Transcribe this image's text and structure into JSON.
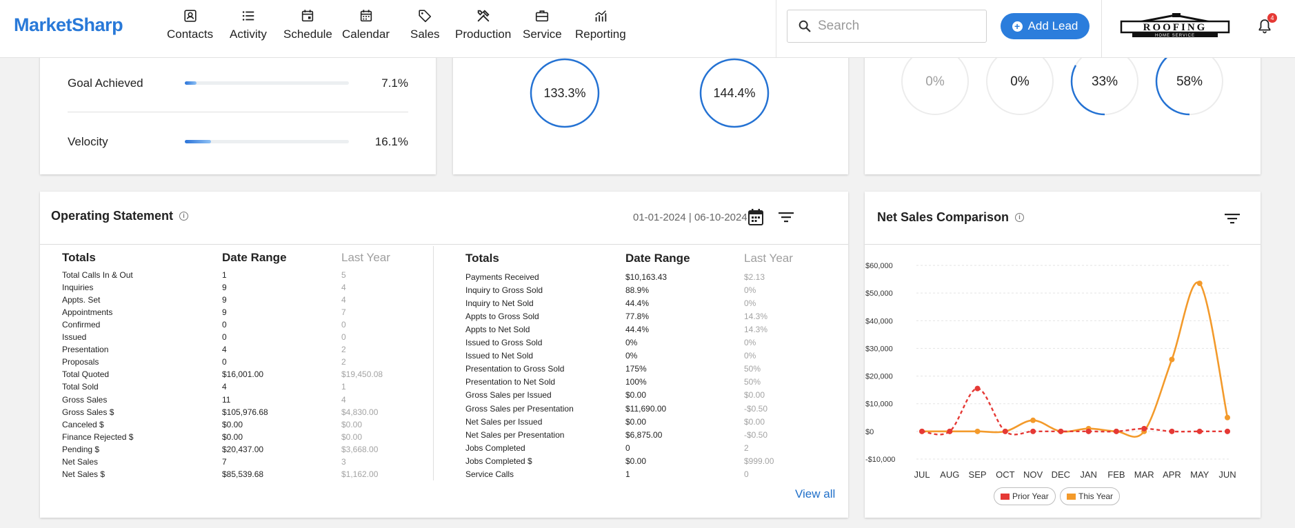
{
  "app": {
    "logo_text": "MarketSharp"
  },
  "nav": {
    "items": [
      {
        "label": "Contacts",
        "icon": "contacts-icon"
      },
      {
        "label": "Activity",
        "icon": "list-icon"
      },
      {
        "label": "Schedule",
        "icon": "calendar-event-icon"
      },
      {
        "label": "Calendar",
        "icon": "calendar-icon"
      },
      {
        "label": "Sales",
        "icon": "tag-icon"
      },
      {
        "label": "Production",
        "icon": "tools-icon"
      },
      {
        "label": "Service",
        "icon": "briefcase-icon"
      },
      {
        "label": "Reporting",
        "icon": "chart-icon"
      }
    ],
    "search_placeholder": "Search",
    "add_lead_label": "Add Lead",
    "brand_logo_text": "ROOFING",
    "brand_logo_subtext": "HOME SERVICE",
    "notification_count": "4"
  },
  "goals_card": {
    "rows": [
      {
        "label": "Goal Achieved",
        "value": "7.1%",
        "fill_percent": 7.1
      },
      {
        "label": "Velocity",
        "value": "16.1%",
        "fill_percent": 16.1
      }
    ]
  },
  "rings_card_middle": {
    "rings": [
      {
        "value": "133.3%",
        "fraction": 1.0
      },
      {
        "value": "144.4%",
        "fraction": 1.0
      }
    ]
  },
  "rings_card_right": {
    "rings": [
      {
        "value": "0%",
        "fraction": 0,
        "muted": true
      },
      {
        "value": "0%",
        "fraction": 0,
        "muted": false
      },
      {
        "value": "33%",
        "fraction": 0.33,
        "muted": false
      },
      {
        "value": "58%",
        "fraction": 0.58,
        "muted": false
      }
    ]
  },
  "operating_statement": {
    "title": "Operating Statement",
    "date_range": "01-01-2024 | 06-10-2024",
    "view_all_label": "View all",
    "left_table": {
      "headers": [
        "Totals",
        "Date Range",
        "Last Year"
      ],
      "rows": [
        [
          "Total Calls In & Out",
          "1",
          "5"
        ],
        [
          "Inquiries",
          "9",
          "4"
        ],
        [
          "Appts. Set",
          "9",
          "4"
        ],
        [
          "Appointments",
          "9",
          "7"
        ],
        [
          "Confirmed",
          "0",
          "0"
        ],
        [
          "Issued",
          "0",
          "0"
        ],
        [
          "Presentation",
          "4",
          "2"
        ],
        [
          "Proposals",
          "0",
          "2"
        ],
        [
          "Total Quoted",
          "$16,001.00",
          "$19,450.08"
        ],
        [
          "Total Sold",
          "4",
          "1"
        ],
        [
          "Gross Sales",
          "11",
          "4"
        ],
        [
          "Gross Sales $",
          "$105,976.68",
          "$4,830.00"
        ],
        [
          "Canceled $",
          "$0.00",
          "$0.00"
        ],
        [
          "Finance Rejected $",
          "$0.00",
          "$0.00"
        ],
        [
          "Pending $",
          "$20,437.00",
          "$3,668.00"
        ],
        [
          "Net Sales",
          "7",
          "3"
        ],
        [
          "Net Sales $",
          "$85,539.68",
          "$1,162.00"
        ]
      ]
    },
    "right_table": {
      "headers": [
        "Totals",
        "Date Range",
        "Last Year"
      ],
      "rows": [
        [
          "Payments Received",
          "$10,163.43",
          "$2.13"
        ],
        [
          "Inquiry to Gross Sold",
          "88.9%",
          "0%"
        ],
        [
          "Inquiry to Net Sold",
          "44.4%",
          "0%"
        ],
        [
          "Appts to Gross Sold",
          "77.8%",
          "14.3%"
        ],
        [
          "Appts to Net Sold",
          "44.4%",
          "14.3%"
        ],
        [
          "Issued to Gross Sold",
          "0%",
          "0%"
        ],
        [
          "Issued to Net Sold",
          "0%",
          "0%"
        ],
        [
          "Presentation to Gross Sold",
          "175%",
          "50%"
        ],
        [
          "Presentation to Net Sold",
          "100%",
          "50%"
        ],
        [
          "Gross Sales per Issued",
          "$0.00",
          "$0.00"
        ],
        [
          "Gross Sales per Presentation",
          "$11,690.00",
          "-$0.50"
        ],
        [
          "Net Sales per Issued",
          "$0.00",
          "$0.00"
        ],
        [
          "Net Sales per Presentation",
          "$6,875.00",
          "-$0.50"
        ],
        [
          "Jobs Completed",
          "0",
          "2"
        ],
        [
          "Jobs Completed $",
          "$0.00",
          "$999.00"
        ],
        [
          "Service Calls",
          "1",
          "0"
        ]
      ]
    }
  },
  "net_sales": {
    "title": "Net Sales Comparison",
    "colors": {
      "prior": "#e53935",
      "this": "#f39a2b"
    }
  },
  "chart_data": {
    "type": "line",
    "title": "Net Sales Comparison",
    "categories": [
      "JUL",
      "AUG",
      "SEP",
      "OCT",
      "NOV",
      "DEC",
      "JAN",
      "FEB",
      "MAR",
      "APR",
      "MAY",
      "JUN"
    ],
    "ylim": [
      -10000,
      60000
    ],
    "yticks": [
      -10000,
      0,
      10000,
      20000,
      30000,
      40000,
      50000,
      60000
    ],
    "ytick_labels": [
      "-$10,000",
      "$0",
      "$10,000",
      "$20,000",
      "$30,000",
      "$40,000",
      "$50,000",
      "$60,000"
    ],
    "grid": true,
    "legend": "bottom",
    "series": [
      {
        "name": "Prior Year",
        "values": [
          0,
          0,
          15500,
          0,
          0,
          0,
          0,
          0,
          1000,
          0,
          0,
          0
        ],
        "style": "dashed",
        "color": "#e53935"
      },
      {
        "name": "This Year",
        "values": [
          0,
          0,
          0,
          0,
          4000,
          0,
          1000,
          0,
          0,
          26000,
          53500,
          5000
        ],
        "style": "solid",
        "color": "#f39a2b"
      }
    ]
  }
}
